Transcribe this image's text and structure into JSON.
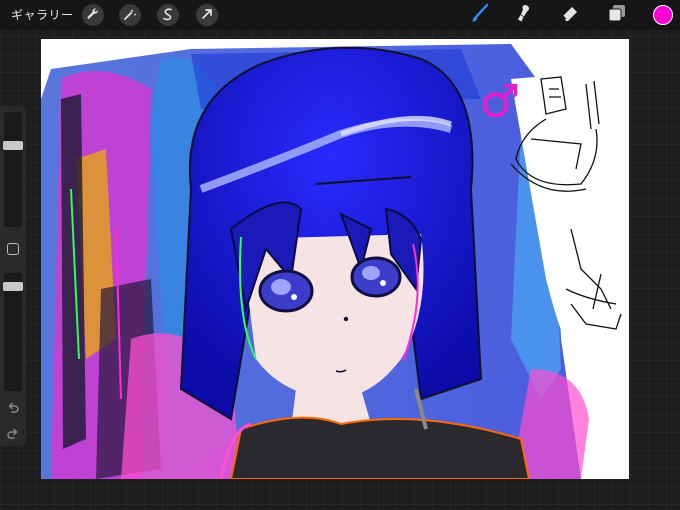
{
  "toolbar": {
    "gallery_label": "ギャラリー",
    "left_tools": [
      "wrench-icon",
      "magic-wand-icon",
      "selection-icon",
      "transform-arrow-icon"
    ],
    "right_tools": [
      "brush-icon",
      "smudge-icon",
      "eraser-icon",
      "layers-icon"
    ],
    "active_tool": "brush",
    "current_color": "#ff00d6"
  },
  "sidebar": {
    "brush_size_level": 0.27,
    "opacity_level": 0.08
  },
  "canvas": {
    "symbol_text": "♂",
    "symbol_color": "#e81ccf"
  }
}
